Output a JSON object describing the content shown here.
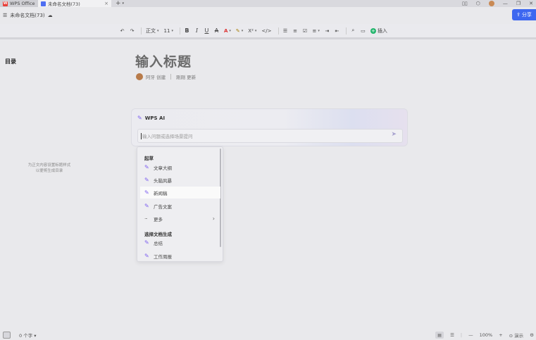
{
  "tabs": [
    {
      "label": "WPS Office"
    },
    {
      "label": "未命名文档(73)"
    }
  ],
  "title_bar": {
    "doc_name": "未命名文档(73)"
  },
  "share_button": {
    "label": "分享"
  },
  "toolbar": {
    "style_label": "正文",
    "font_size": "11",
    "superscript_label": "X²",
    "insert_label": "插入"
  },
  "sidebar": {
    "title": "目录",
    "hint_line1": "为正文内容设置标题样式",
    "hint_line2": "以便将生成目录"
  },
  "document": {
    "title_placeholder": "输入标题",
    "author": "阿牙 创建",
    "updated": "刚刚 更新"
  },
  "ai_panel": {
    "title": "WPS AI",
    "input_placeholder": "输入问题或选择场景提问"
  },
  "menu": {
    "section1": "起草",
    "items1": [
      "文章大纲",
      "头脑风暴",
      "新闻稿",
      "广告文案",
      "更多"
    ],
    "section2": "选择文档生成",
    "items2": [
      "总结",
      "工作周报"
    ]
  },
  "status_bar": {
    "word_count": "0 个字",
    "zoom": "100%",
    "present_label": "演示"
  },
  "colors": {
    "accent_blue": "#3d67f0",
    "ai_purple": "#7b5cf0",
    "insert_green": "#21b56b"
  }
}
